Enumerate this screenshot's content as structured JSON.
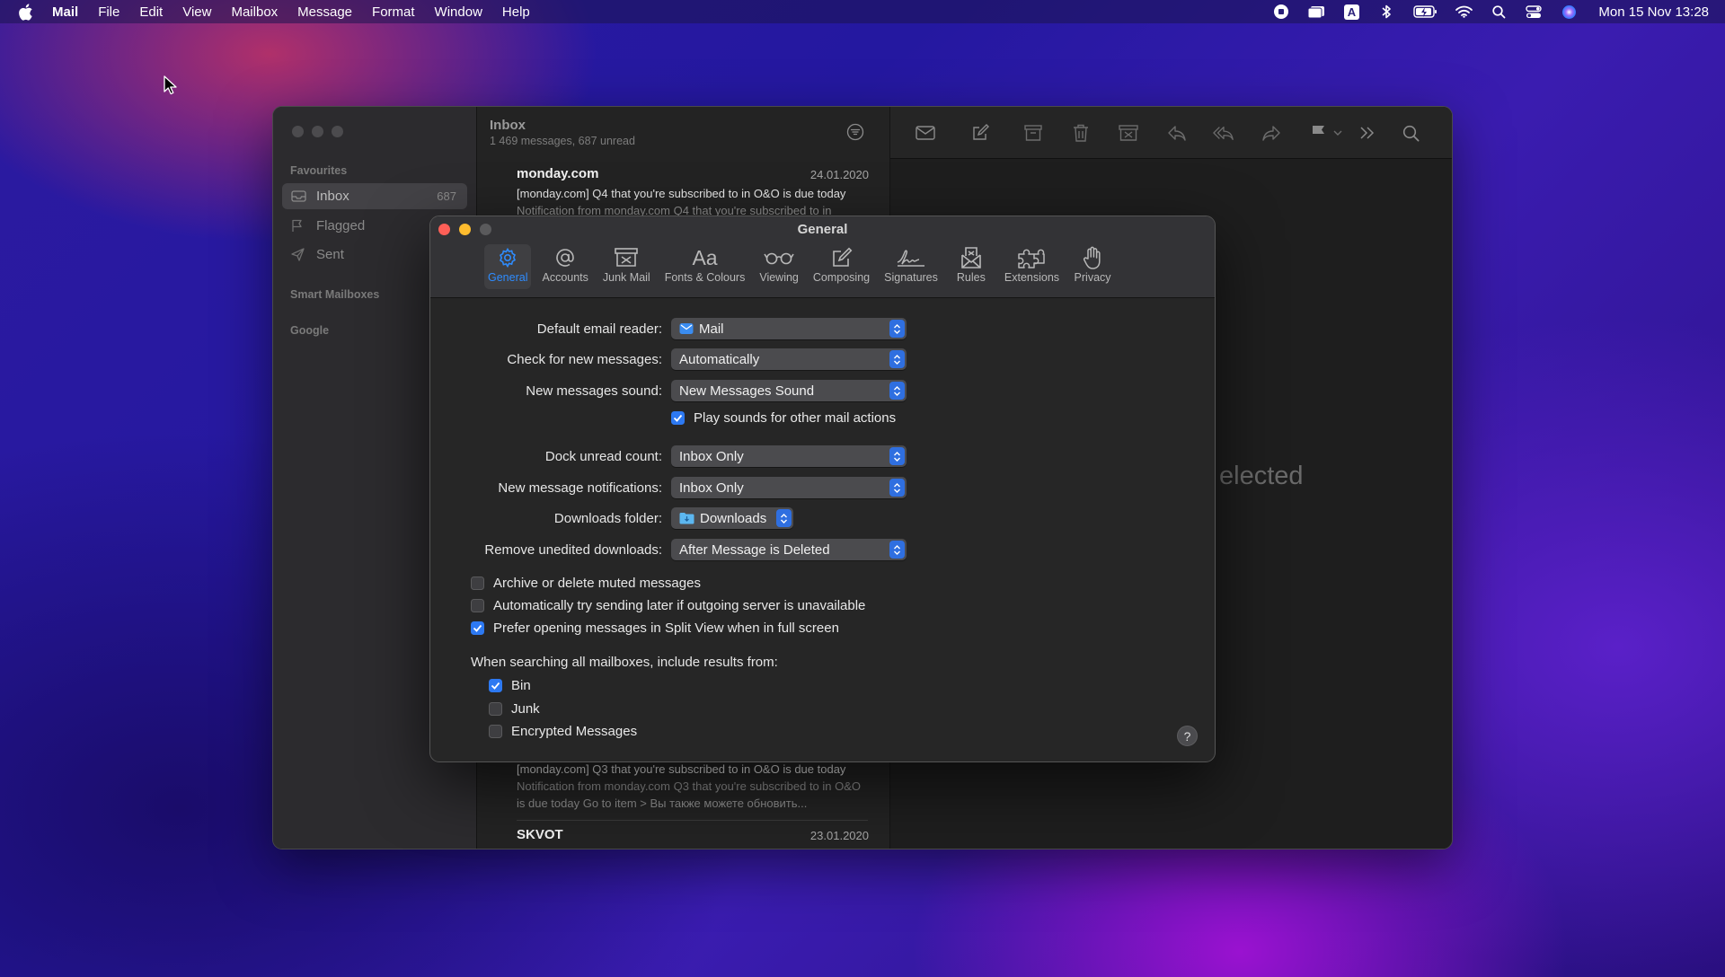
{
  "menubar": {
    "app_name": "Mail",
    "items": [
      "File",
      "Edit",
      "View",
      "Mailbox",
      "Message",
      "Format",
      "Window",
      "Help"
    ],
    "status_icons": [
      "record-icon",
      "notification-icon",
      "input-source-icon",
      "bluetooth-icon",
      "battery-icon",
      "wifi-icon",
      "spotlight-icon",
      "control-center-icon",
      "siri-icon"
    ],
    "input_source_letter": "A",
    "clock": "Mon 15 Nov  13:28"
  },
  "sidebar": {
    "favourites_label": "Favourites",
    "items": [
      {
        "label": "Inbox",
        "count": "687",
        "icon": "inbox-icon"
      },
      {
        "label": "Flagged",
        "icon": "flag-icon"
      },
      {
        "label": "Sent",
        "icon": "paper-plane-icon"
      }
    ],
    "smart_mailboxes_label": "Smart Mailboxes",
    "google_label": "Google"
  },
  "message_list": {
    "title": "Inbox",
    "subtitle": "1 469 messages, 687 unread",
    "messages": [
      {
        "from": "monday.com",
        "date": "24.01.2020",
        "subject": "[monday.com] Q4 that you're subscribed to in O&O is due today",
        "preview": "Notification from monday.com Q4 that you're subscribed to in"
      },
      {
        "from": "",
        "date": "",
        "subject": "[monday.com] Q3 that you're subscribed to in O&O is due today",
        "preview": "Notification from monday.com Q3 that you're subscribed to in O&O is due today Go to item > Вы также можете обновить..."
      },
      {
        "from": "SKVOT",
        "date": "23.01.2020"
      }
    ]
  },
  "content": {
    "no_selection_text": "elected"
  },
  "prefs": {
    "title": "General",
    "tabs": [
      {
        "label": "General",
        "icon": "gear-icon"
      },
      {
        "label": "Accounts",
        "icon": "at-sign-icon"
      },
      {
        "label": "Junk Mail",
        "icon": "junk-tray-icon"
      },
      {
        "label": "Fonts & Colours",
        "icon": "fonts-icon",
        "glyph": "Aa"
      },
      {
        "label": "Viewing",
        "icon": "glasses-icon"
      },
      {
        "label": "Composing",
        "icon": "compose-icon"
      },
      {
        "label": "Signatures",
        "icon": "signature-icon"
      },
      {
        "label": "Rules",
        "icon": "rules-envelope-icon"
      },
      {
        "label": "Extensions",
        "icon": "puzzle-icon"
      },
      {
        "label": "Privacy",
        "icon": "hand-icon"
      }
    ],
    "fields": {
      "default_reader_label": "Default email reader:",
      "default_reader_value": "Mail",
      "check_new_label": "Check for new messages:",
      "check_new_value": "Automatically",
      "sound_label": "New messages sound:",
      "sound_value": "New Messages Sound",
      "play_sounds_label": "Play sounds for other mail actions",
      "dock_label": "Dock unread count:",
      "dock_value": "Inbox Only",
      "notif_label": "New message notifications:",
      "notif_value": "Inbox Only",
      "downloads_label": "Downloads folder:",
      "downloads_value": "Downloads",
      "remove_label": "Remove unedited downloads:",
      "remove_value": "After Message is Deleted"
    },
    "options": {
      "archive_muted": "Archive or delete muted messages",
      "send_later": "Automatically try sending later if outgoing server is unavailable",
      "split_view": "Prefer opening messages in Split View when in full screen"
    },
    "search_section": {
      "label": "When searching all mailboxes, include results from:",
      "bin": "Bin",
      "junk": "Junk",
      "encrypted": "Encrypted Messages"
    },
    "help_label": "?",
    "checkbox_states": {
      "play_sounds": true,
      "archive_muted": false,
      "send_later": false,
      "split_view": true,
      "bin": true,
      "junk": false,
      "encrypted": false
    }
  },
  "colors": {
    "accent": "#2e8cff",
    "checkbox_on": "#2d79f2",
    "close": "#fe5f57",
    "minimize": "#febc2e"
  }
}
